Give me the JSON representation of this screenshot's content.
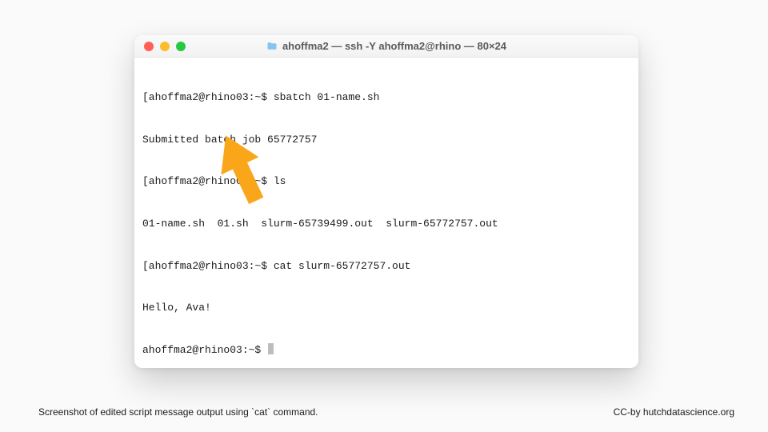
{
  "window": {
    "title": "ahoffma2 — ssh -Y ahoffma2@rhino — 80×24",
    "traffic": {
      "close": "#ff5f57",
      "min": "#febc2e",
      "max": "#28c840"
    }
  },
  "prompt": "ahoffma2@rhino03:~$ ",
  "terminal": {
    "lines": [
      "[ahoffma2@rhino03:~$ sbatch 01-name.sh",
      "Submitted batch job 65772757",
      "[ahoffma2@rhino03:~$ ls",
      "01-name.sh  01.sh  slurm-65739499.out  slurm-65772757.out",
      "[ahoffma2@rhino03:~$ cat slurm-65772757.out",
      "Hello, Ava!"
    ]
  },
  "caption_left": "Screenshot of edited script message output using `cat` command.",
  "caption_right": "CC-by hutchdatascience.org",
  "arrow_color": "#faa61a"
}
